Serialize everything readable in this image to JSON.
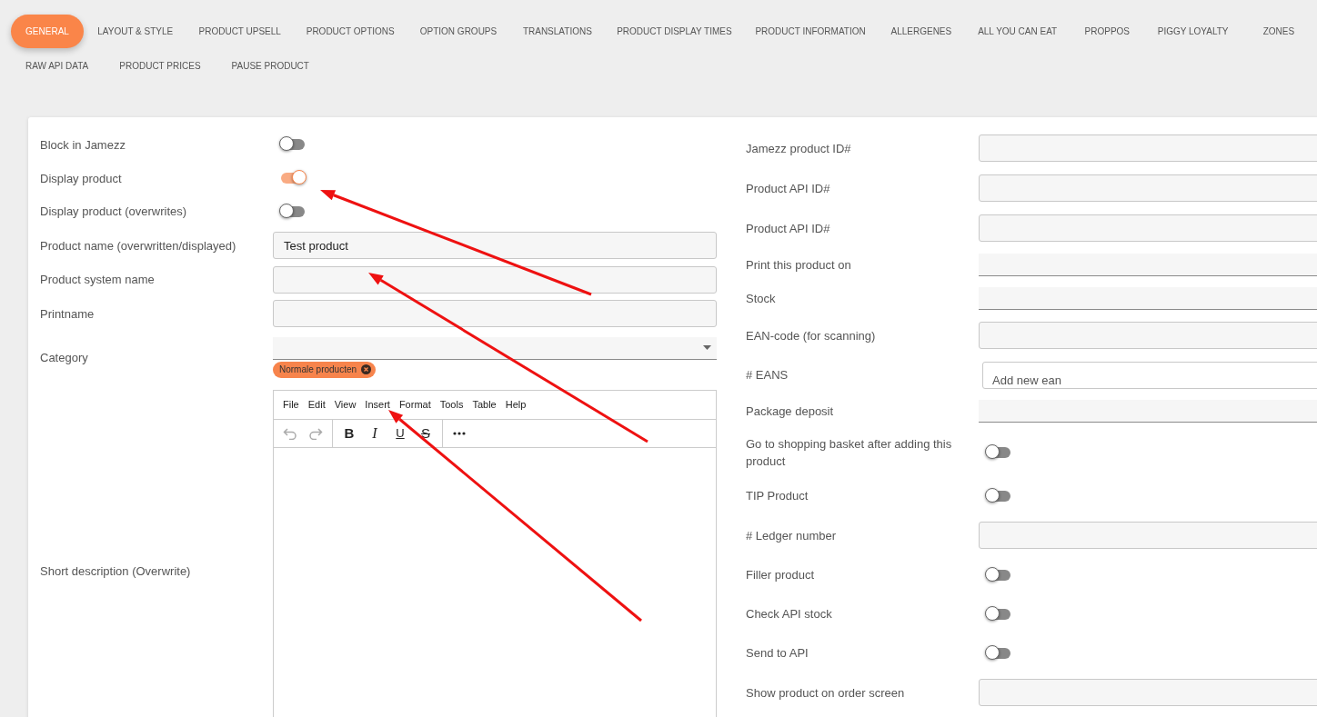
{
  "tab_rows": [
    [
      {
        "label": "GENERAL",
        "selected": true
      },
      {
        "label": "LAYOUT & STYLE",
        "selected": false
      },
      {
        "label": "PRODUCT UPSELL",
        "selected": false
      },
      {
        "label": "PRODUCT OPTIONS",
        "selected": false
      },
      {
        "label": "OPTION GROUPS",
        "selected": false
      },
      {
        "label": "TRANSLATIONS",
        "selected": false
      },
      {
        "label": "PRODUCT DISPLAY TIMES",
        "selected": false
      },
      {
        "label": "PRODUCT INFORMATION",
        "selected": false
      },
      {
        "label": "ALLERGENES",
        "selected": false
      },
      {
        "label": "ALL YOU CAN EAT",
        "selected": false
      },
      {
        "label": "PROPPOS",
        "selected": false
      },
      {
        "label": "PIGGY LOYALTY",
        "selected": false
      },
      {
        "label": "ZONES",
        "selected": false
      }
    ],
    [
      {
        "label": "RAW API DATA",
        "selected": false
      },
      {
        "label": "PRODUCT PRICES",
        "selected": false
      },
      {
        "label": "PAUSE PRODUCT",
        "selected": false
      }
    ]
  ],
  "left_fields": [
    {
      "kind": "toggle",
      "label": "Block in Jamezz",
      "on": false
    },
    {
      "kind": "toggle",
      "label": "Display product",
      "on": true
    },
    {
      "kind": "toggle",
      "label": "Display product (overwrites)",
      "on": false
    },
    {
      "kind": "text",
      "label": "Product name (overwritten/displayed)",
      "value": "Test product"
    },
    {
      "kind": "text",
      "label": "Product system name"
    },
    {
      "kind": "text",
      "label": "Printname"
    },
    {
      "kind": "select",
      "label": "Category",
      "chips": [
        "Normale producten"
      ]
    },
    {
      "kind": "editor",
      "label": "Short description (Overwrite)",
      "menu": [
        "File",
        "Edit",
        "View",
        "Insert",
        "Format",
        "Tools",
        "Table",
        "Help"
      ],
      "toolbar": [
        [
          {
            "kind": "undo",
            "disabled": true
          },
          {
            "kind": "redo",
            "disabled": true
          }
        ],
        [
          {
            "kind": "bold",
            "label": "B"
          },
          {
            "kind": "italic",
            "label": "I"
          },
          {
            "kind": "underline",
            "label": "U"
          },
          {
            "kind": "strike",
            "label": "S"
          }
        ],
        [
          {
            "kind": "more"
          }
        ]
      ]
    }
  ],
  "right_fields": [
    {
      "kind": "text",
      "label": "Jamezz product ID#"
    },
    {
      "kind": "text",
      "label": "Product API ID#"
    },
    {
      "kind": "text",
      "label": "Product API ID#"
    },
    {
      "kind": "underline",
      "label": "Print this product on"
    },
    {
      "kind": "underline",
      "label": "Stock"
    },
    {
      "kind": "text",
      "label": "EAN-code (for scanning)"
    },
    {
      "kind": "tags",
      "label": "# EANS",
      "placeholder": "Add new ean"
    },
    {
      "kind": "underline",
      "label": "Package deposit"
    },
    {
      "kind": "toggle",
      "label": "Go to shopping basket after adding this product",
      "on": false
    },
    {
      "kind": "toggle",
      "label": "TIP Product",
      "on": false
    },
    {
      "kind": "text",
      "label": "# Ledger number"
    },
    {
      "kind": "toggle",
      "label": "Filler product",
      "on": false
    },
    {
      "kind": "toggle",
      "label": "Check API stock",
      "on": false
    },
    {
      "kind": "toggle",
      "label": "Send to API",
      "on": false
    },
    {
      "kind": "text",
      "label": "Show product on order screen"
    }
  ]
}
